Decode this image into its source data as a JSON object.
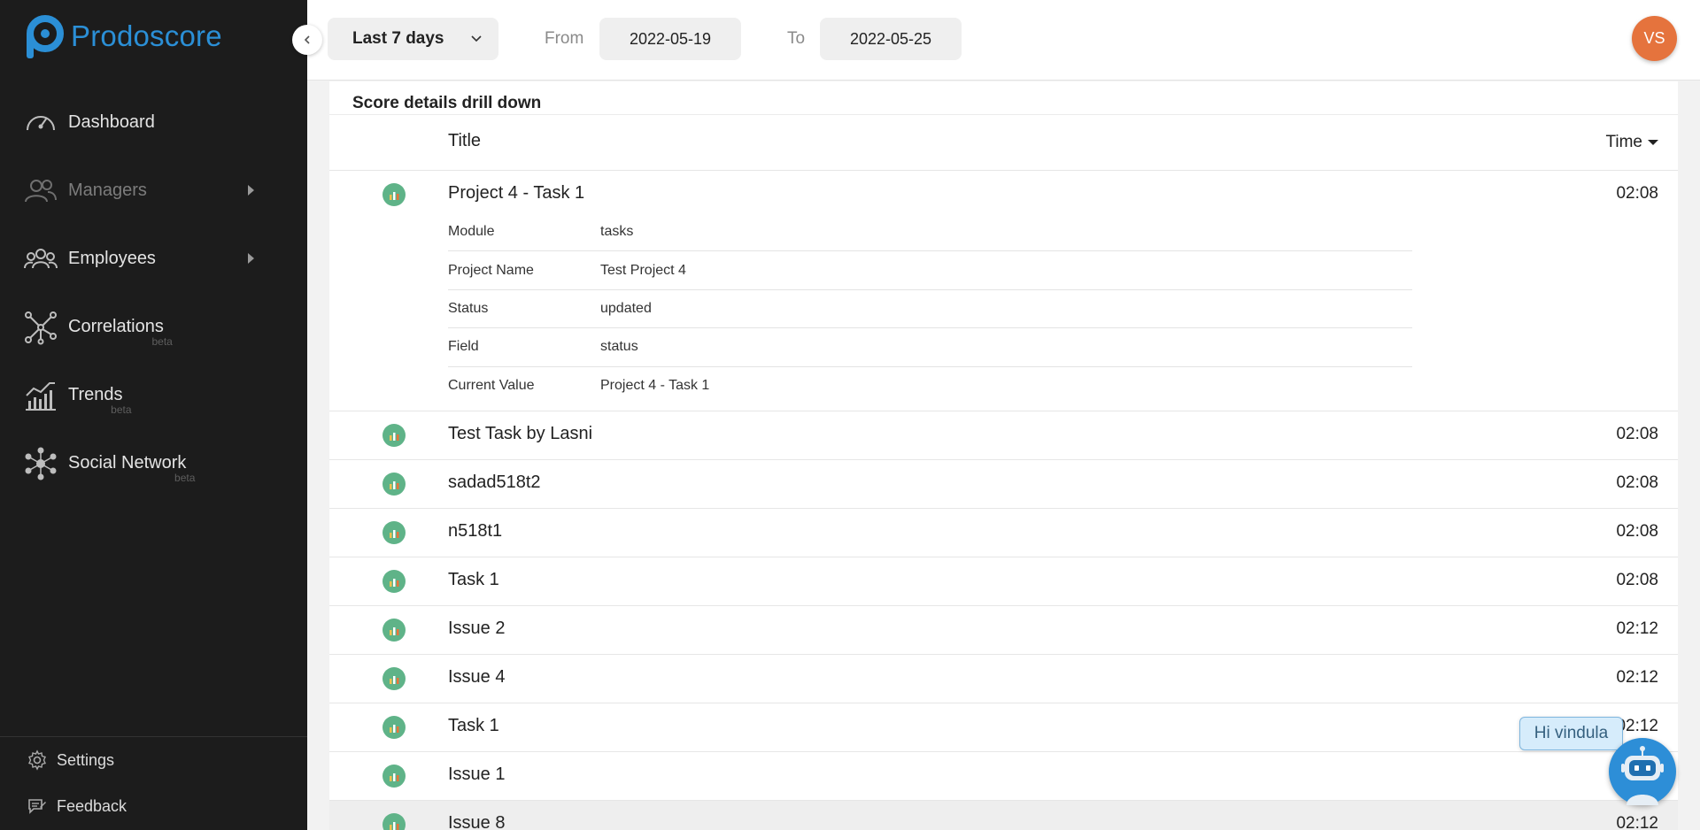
{
  "brand": {
    "name": "Prodoscore"
  },
  "sidebar": {
    "items": [
      {
        "label": "Dashboard",
        "icon": "speedometer-icon",
        "beta": "",
        "has_arrow": false
      },
      {
        "label": "Managers",
        "icon": "managers-icon",
        "beta": "",
        "has_arrow": true
      },
      {
        "label": "Employees",
        "icon": "employees-icon",
        "beta": "",
        "has_arrow": true
      },
      {
        "label": "Correlations",
        "icon": "network-icon",
        "beta": "beta",
        "has_arrow": false
      },
      {
        "label": "Trends",
        "icon": "trend-chart-icon",
        "beta": "beta",
        "has_arrow": false
      },
      {
        "label": "Social Network",
        "icon": "social-network-icon",
        "beta": "beta",
        "has_arrow": false
      }
    ],
    "bottom": [
      {
        "label": "Settings",
        "icon": "gear-icon"
      },
      {
        "label": "Feedback",
        "icon": "feedback-icon"
      }
    ]
  },
  "topbar": {
    "range": "Last 7 days",
    "from_label": "From",
    "from_date": "2022-05-19",
    "to_label": "To",
    "to_date": "2022-05-25",
    "avatar_initials": "VS"
  },
  "section": {
    "title": "Score details drill down"
  },
  "table": {
    "headers": {
      "title": "Title",
      "time": "Time"
    },
    "expanded_row": {
      "title": "Project 4 - Task 1",
      "time": "02:08",
      "details": [
        {
          "key": "Module",
          "value": "tasks"
        },
        {
          "key": "Project Name",
          "value": "Test Project 4"
        },
        {
          "key": "Status",
          "value": "updated"
        },
        {
          "key": "Field",
          "value": "status"
        },
        {
          "key": "Current Value",
          "value": "Project 4 - Task 1"
        }
      ]
    },
    "rows": [
      {
        "title": "Test Task by Lasni",
        "time": "02:08"
      },
      {
        "title": "sadad518t2",
        "time": "02:08"
      },
      {
        "title": "n518t1",
        "time": "02:08"
      },
      {
        "title": "Task 1",
        "time": "02:08"
      },
      {
        "title": "Issue 2",
        "time": "02:12"
      },
      {
        "title": "Issue 4",
        "time": "02:12"
      },
      {
        "title": "Task 1",
        "time": "02:12"
      },
      {
        "title": "Issue 1",
        "time": ""
      },
      {
        "title": "Issue 8",
        "time": "02:12"
      }
    ]
  },
  "chat": {
    "greeting": "Hi vindula"
  },
  "colors": {
    "brand": "#2b8fd6",
    "sidebar_bg": "#1c1c1c",
    "avatar": "#e5733d",
    "row_icon": "#5fb388",
    "bot": "#2d8ed7"
  }
}
